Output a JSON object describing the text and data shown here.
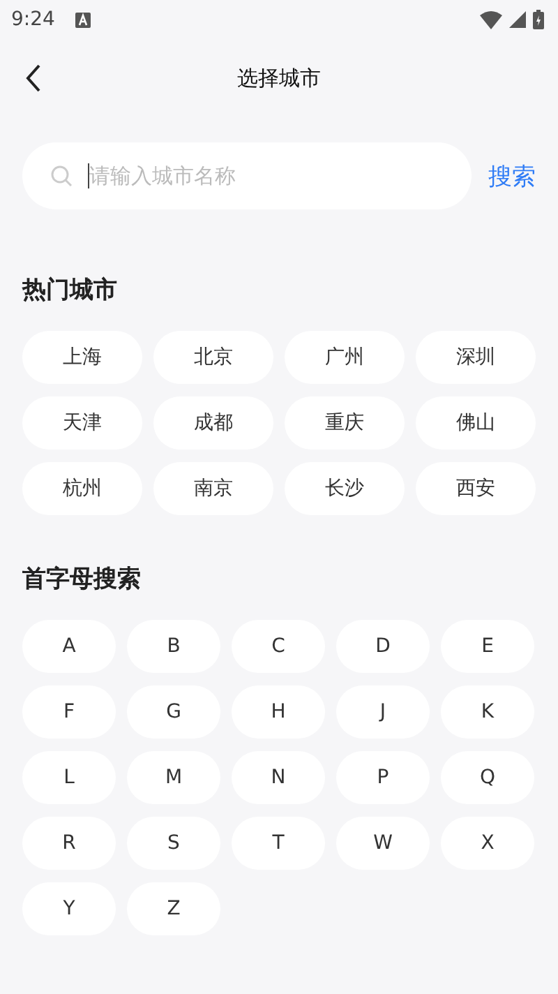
{
  "status_bar": {
    "time": "9:24"
  },
  "header": {
    "title": "选择城市"
  },
  "search": {
    "placeholder": "请输入城市名称",
    "button": "搜索"
  },
  "hot_cities": {
    "title": "热门城市",
    "items": [
      "上海",
      "北京",
      "广州",
      "深圳",
      "天津",
      "成都",
      "重庆",
      "佛山",
      "杭州",
      "南京",
      "长沙",
      "西安"
    ]
  },
  "letters": {
    "title": "首字母搜索",
    "items": [
      "A",
      "B",
      "C",
      "D",
      "E",
      "F",
      "G",
      "H",
      "J",
      "K",
      "L",
      "M",
      "N",
      "P",
      "Q",
      "R",
      "S",
      "T",
      "W",
      "X",
      "Y",
      "Z"
    ]
  }
}
